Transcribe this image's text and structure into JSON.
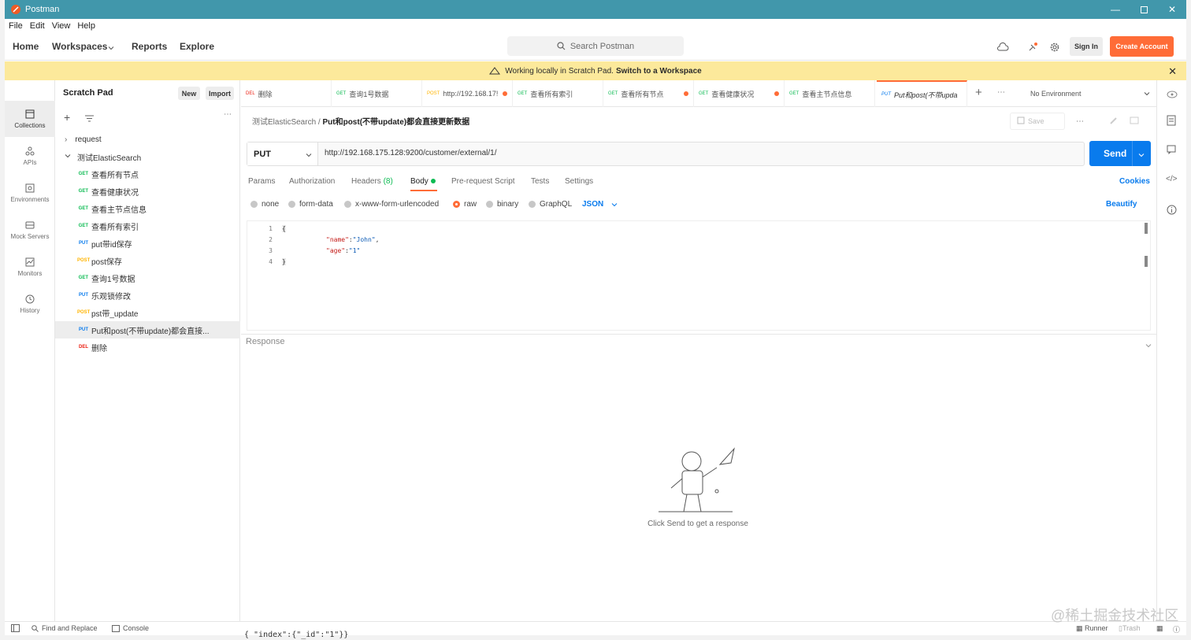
{
  "titlebar": {
    "title": "Postman"
  },
  "menu": [
    "File",
    "Edit",
    "View",
    "Help"
  ],
  "header": {
    "home": "Home",
    "workspaces": "Workspaces",
    "reports": "Reports",
    "explore": "Explore",
    "search_placeholder": "Search Postman",
    "signin": "Sign In",
    "create": "Create Account"
  },
  "banner": {
    "text": "Working locally in Scratch Pad.",
    "link": "Switch to a Workspace"
  },
  "rail": [
    {
      "label": "Collections"
    },
    {
      "label": "APIs"
    },
    {
      "label": "Environments"
    },
    {
      "label": "Mock Servers"
    },
    {
      "label": "Monitors"
    },
    {
      "label": "History"
    }
  ],
  "sidebar": {
    "title": "Scratch Pad",
    "new": "New",
    "import": "Import",
    "items": [
      {
        "method": "",
        "label": "request"
      },
      {
        "method": "",
        "label": "测试ElasticSearch"
      },
      {
        "method": "GET",
        "label": "查看所有节点"
      },
      {
        "method": "GET",
        "label": "查看健康状况"
      },
      {
        "method": "GET",
        "label": "查看主节点信息"
      },
      {
        "method": "GET",
        "label": "查看所有索引"
      },
      {
        "method": "PUT",
        "label": "put带id保存"
      },
      {
        "method": "POST",
        "label": "post保存"
      },
      {
        "method": "GET",
        "label": "查询1号数据"
      },
      {
        "method": "PUT",
        "label": "乐观锁修改"
      },
      {
        "method": "POST",
        "label": "pst带_update"
      },
      {
        "method": "PUT",
        "label": "Put和post(不带update)都会直接..."
      },
      {
        "method": "DEL",
        "label": "删除"
      }
    ]
  },
  "tabs": [
    {
      "method": "DEL",
      "label": "删除"
    },
    {
      "method": "GET",
      "label": "查询1号数据"
    },
    {
      "method": "POST",
      "label": "http://192.168.17!"
    },
    {
      "method": "GET",
      "label": "查看所有索引"
    },
    {
      "method": "GET",
      "label": "查看所有节点"
    },
    {
      "method": "GET",
      "label": "查看健康状况"
    },
    {
      "method": "GET",
      "label": "查看主节点信息"
    },
    {
      "method": "PUT",
      "label": "Put和post(不带upda"
    }
  ],
  "environment": "No Environment",
  "breadcrumb": {
    "collection": "测试ElasticSearch",
    "sep": "/",
    "request": "Put和post(不带update)都会直接更新数据"
  },
  "save": "Save",
  "request": {
    "method": "PUT",
    "url": "http://192.168.175.128:9200/customer/external/1/",
    "send": "Send"
  },
  "reqtabs": {
    "params": "Params",
    "auth": "Authorization",
    "headers": "Headers",
    "headers_count": "(8)",
    "body": "Body",
    "prereq": "Pre-request Script",
    "tests": "Tests",
    "settings": "Settings",
    "cookies": "Cookies"
  },
  "bodyopts": {
    "none": "none",
    "formdata": "form-data",
    "urlenc": "x-www-form-urlencoded",
    "raw": "raw",
    "binary": "binary",
    "graphql": "GraphQL",
    "json": "JSON",
    "beautify": "Beautify"
  },
  "code": {
    "l1": "{",
    "k1": "\"name\"",
    "v1": "\"John\"",
    "k2": "\"age\"",
    "v2": "\"1\"",
    "l4": "}"
  },
  "response": {
    "label": "Response",
    "hint": "Click Send to get a response"
  },
  "status": {
    "find": "Find and Replace",
    "console": "Console",
    "runner": "Runner",
    "trash": "Trash"
  },
  "background_text": "{ \"index\":{\"_id\":\"1\"}}",
  "watermark": "@稀土掘金技术社区",
  "colors": {
    "accent": "#ff6c37",
    "send": "#097bed",
    "titlebar": "#4197ab",
    "banner": "#fce99b"
  }
}
